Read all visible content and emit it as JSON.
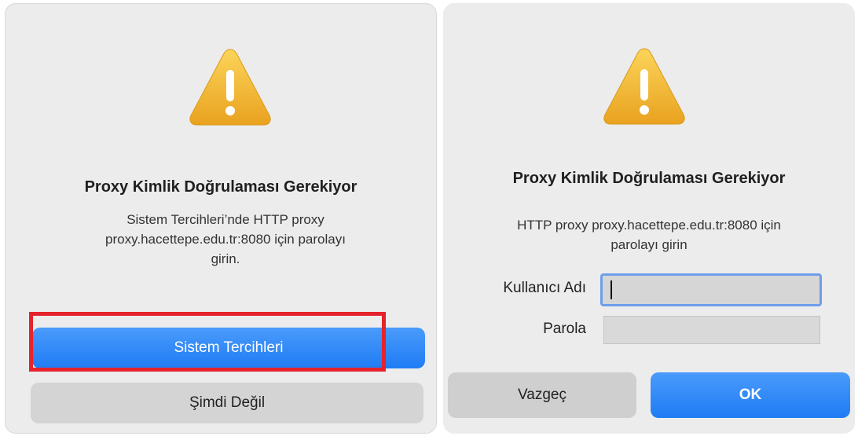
{
  "left_dialog": {
    "title": "Proxy Kimlik Doğrulaması Gerekiyor",
    "message_line1": "Sistem Tercihleri’nde HTTP proxy",
    "message_line2": "proxy.hacettepe.edu.tr:8080 için parolayı",
    "message_line3": "girin.",
    "primary_button": "Sistem Tercihleri",
    "secondary_button": "Şimdi Değil",
    "icon": "warning-triangle-icon",
    "highlight_color": "#e5232d"
  },
  "right_dialog": {
    "title": "Proxy Kimlik Doğrulaması Gerekiyor",
    "message_line1": "HTTP proxy proxy.hacettepe.edu.tr:8080 için",
    "message_line2": "parolayı girin",
    "username_label": "Kullanıcı Adı",
    "username_value": "",
    "password_label": "Parola",
    "password_value": "",
    "cancel_button": "Vazgeç",
    "ok_button": "OK",
    "icon": "warning-triangle-icon"
  },
  "colors": {
    "primary": "#1f7cf4",
    "dialog_bg": "#ececec",
    "warning": "#f2b632"
  }
}
